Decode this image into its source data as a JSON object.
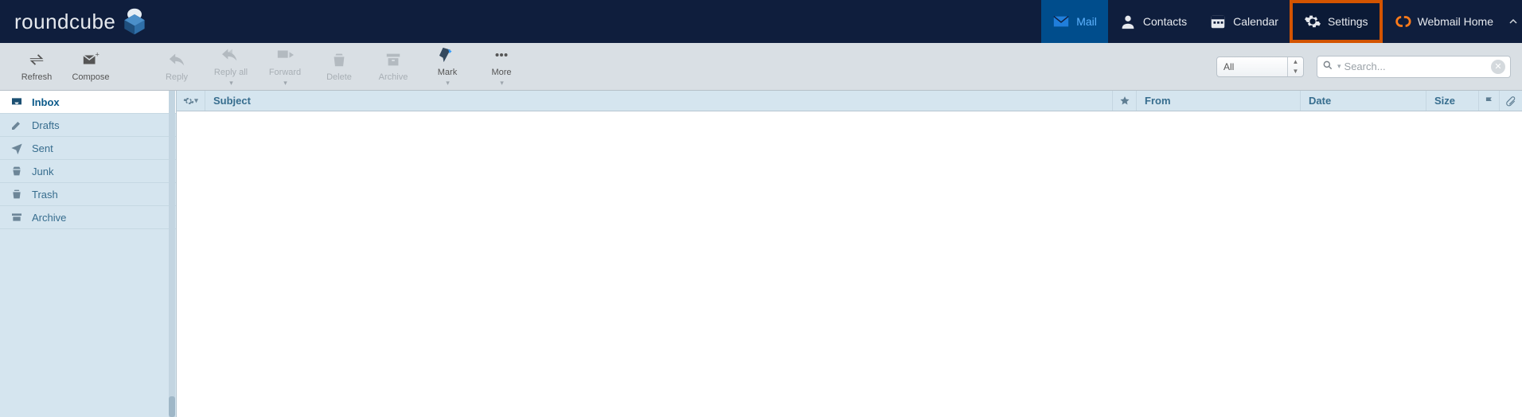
{
  "brand": "roundcube",
  "nav": {
    "mail": "Mail",
    "contacts": "Contacts",
    "calendar": "Calendar",
    "settings": "Settings",
    "webmail_home": "Webmail Home"
  },
  "toolbar": {
    "refresh": "Refresh",
    "compose": "Compose",
    "reply": "Reply",
    "reply_all": "Reply all",
    "forward": "Forward",
    "delete": "Delete",
    "archive": "Archive",
    "mark": "Mark",
    "more": "More"
  },
  "filter": {
    "scope": "All"
  },
  "search": {
    "placeholder": "Search..."
  },
  "folders": {
    "inbox": "Inbox",
    "drafts": "Drafts",
    "sent": "Sent",
    "junk": "Junk",
    "trash": "Trash",
    "archive": "Archive"
  },
  "columns": {
    "subject": "Subject",
    "from": "From",
    "date": "Date",
    "size": "Size"
  }
}
